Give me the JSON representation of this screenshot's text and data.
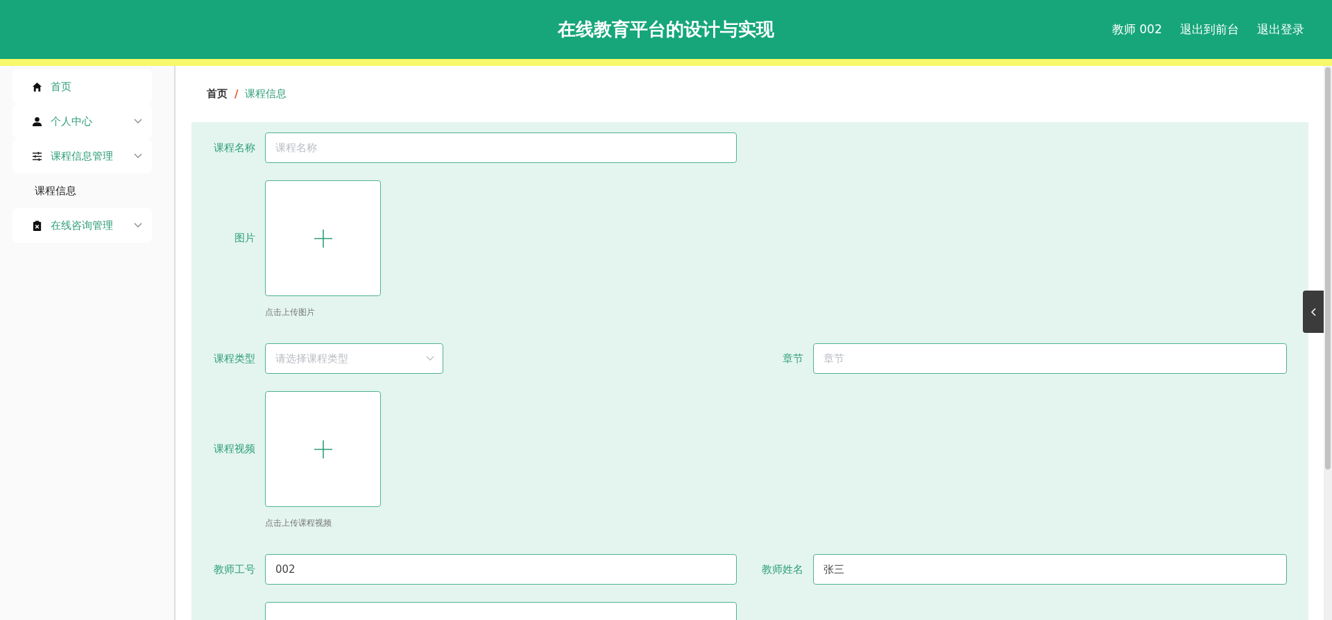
{
  "header": {
    "title": "在线教育平台的设计与实现",
    "links": [
      "教师 002",
      "退出到前台",
      "退出登录"
    ]
  },
  "sidebar": {
    "items": [
      {
        "label": "首页",
        "has_menu": false
      },
      {
        "label": "个人中心",
        "has_menu": true
      },
      {
        "label": "课程信息管理",
        "has_menu": true,
        "children": [
          {
            "label": "课程信息"
          }
        ]
      },
      {
        "label": "在线咨询管理",
        "has_menu": true
      }
    ]
  },
  "breadcrumb": {
    "separator": "/",
    "items": [
      "首页",
      "课程信息"
    ]
  },
  "form": {
    "rows": [
      {
        "fields": [
          {
            "kind": "text",
            "label": "课程名称",
            "placeholder": "课程名称"
          }
        ]
      },
      {
        "fields": [
          {
            "kind": "upload",
            "label": "图片",
            "hint": "点击上传图片"
          }
        ]
      },
      {
        "fields": [
          {
            "kind": "select",
            "label": "课程类型",
            "placeholder": "请选择课程类型"
          },
          {
            "kind": "text",
            "label": "章节",
            "placeholder": "章节"
          }
        ]
      },
      {
        "fields": [
          {
            "kind": "upload",
            "label": "课程视频",
            "hint": "点击上传课程视频"
          }
        ]
      },
      {
        "fields": [
          {
            "kind": "text",
            "label": "教师工号",
            "value": "002"
          },
          {
            "kind": "text",
            "label": "教师姓名",
            "value": "张三"
          }
        ]
      },
      {
        "fields": [
          {
            "kind": "text"
          }
        ]
      }
    ]
  }
}
